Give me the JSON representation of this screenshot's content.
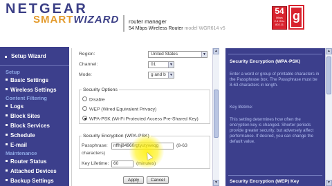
{
  "header": {
    "brand_top": "NETGEAR",
    "brand_smart": "SMART",
    "brand_wizard": "WIZARD",
    "title": "router manager",
    "subtitle": "54 Mbps Wireless Router",
    "model": "model WGR614 v5",
    "badge_speed": "54",
    "badge_speed_unit": "Mbps",
    "badge_band": "2.4 GHz",
    "badge_standard": "802.11",
    "badge_letter": "g"
  },
  "sidebar": {
    "setup_wizard": "Setup Wizard",
    "sections": [
      {
        "label": "Setup",
        "items": [
          "Basic Settings",
          "Wireless Settings"
        ]
      },
      {
        "label": "Content Filtering",
        "items": [
          "Logs",
          "Block Sites",
          "Block Services",
          "Schedule",
          "E-mail"
        ]
      },
      {
        "label": "Maintenance",
        "items": [
          "Router Status",
          "Attached Devices",
          "Backup Settings"
        ]
      }
    ]
  },
  "form": {
    "region_label": "Region:",
    "region_value": "United States",
    "channel_label": "Channel:",
    "channel_value": "01",
    "mode_label": "Mode:",
    "mode_value": "g and b",
    "security_options_legend": "Security Options",
    "options": [
      "Disable",
      "WEP (Wired Equivalent Privacy)",
      "WPA-PSK (Wi-Fi Protected Access Pre-Shared Key)"
    ],
    "selected_option": 2,
    "wpa_legend": "Security Encryption (WPA-PSK)",
    "passphrase_label": "Passphrase:",
    "passphrase_value": "nffhj84960rgtyutyweqg",
    "passphrase_hint": "(8-63",
    "passphrase_hint2": "characters)",
    "key_lifetime_label": "Key Lifetime:",
    "key_lifetime_value": "60",
    "key_lifetime_unit": "(minutes)",
    "apply_label": "Apply",
    "cancel_label": "Cancel"
  },
  "help": {
    "title": "Security Encryption (WPA-PSK)",
    "text1": "Enter a word or group of printable characters in the Passphrase box. The Passphrase must be 8-63 characters in length.",
    "key_lifetime_title": "Key lifetime:",
    "text2": "This setting determines how often the encryption key is changed. Shorter periods provide greater security, but adversely affect performance. If desired, you can change the default value.",
    "next_title": "Security Encryption (WEP) Key"
  }
}
